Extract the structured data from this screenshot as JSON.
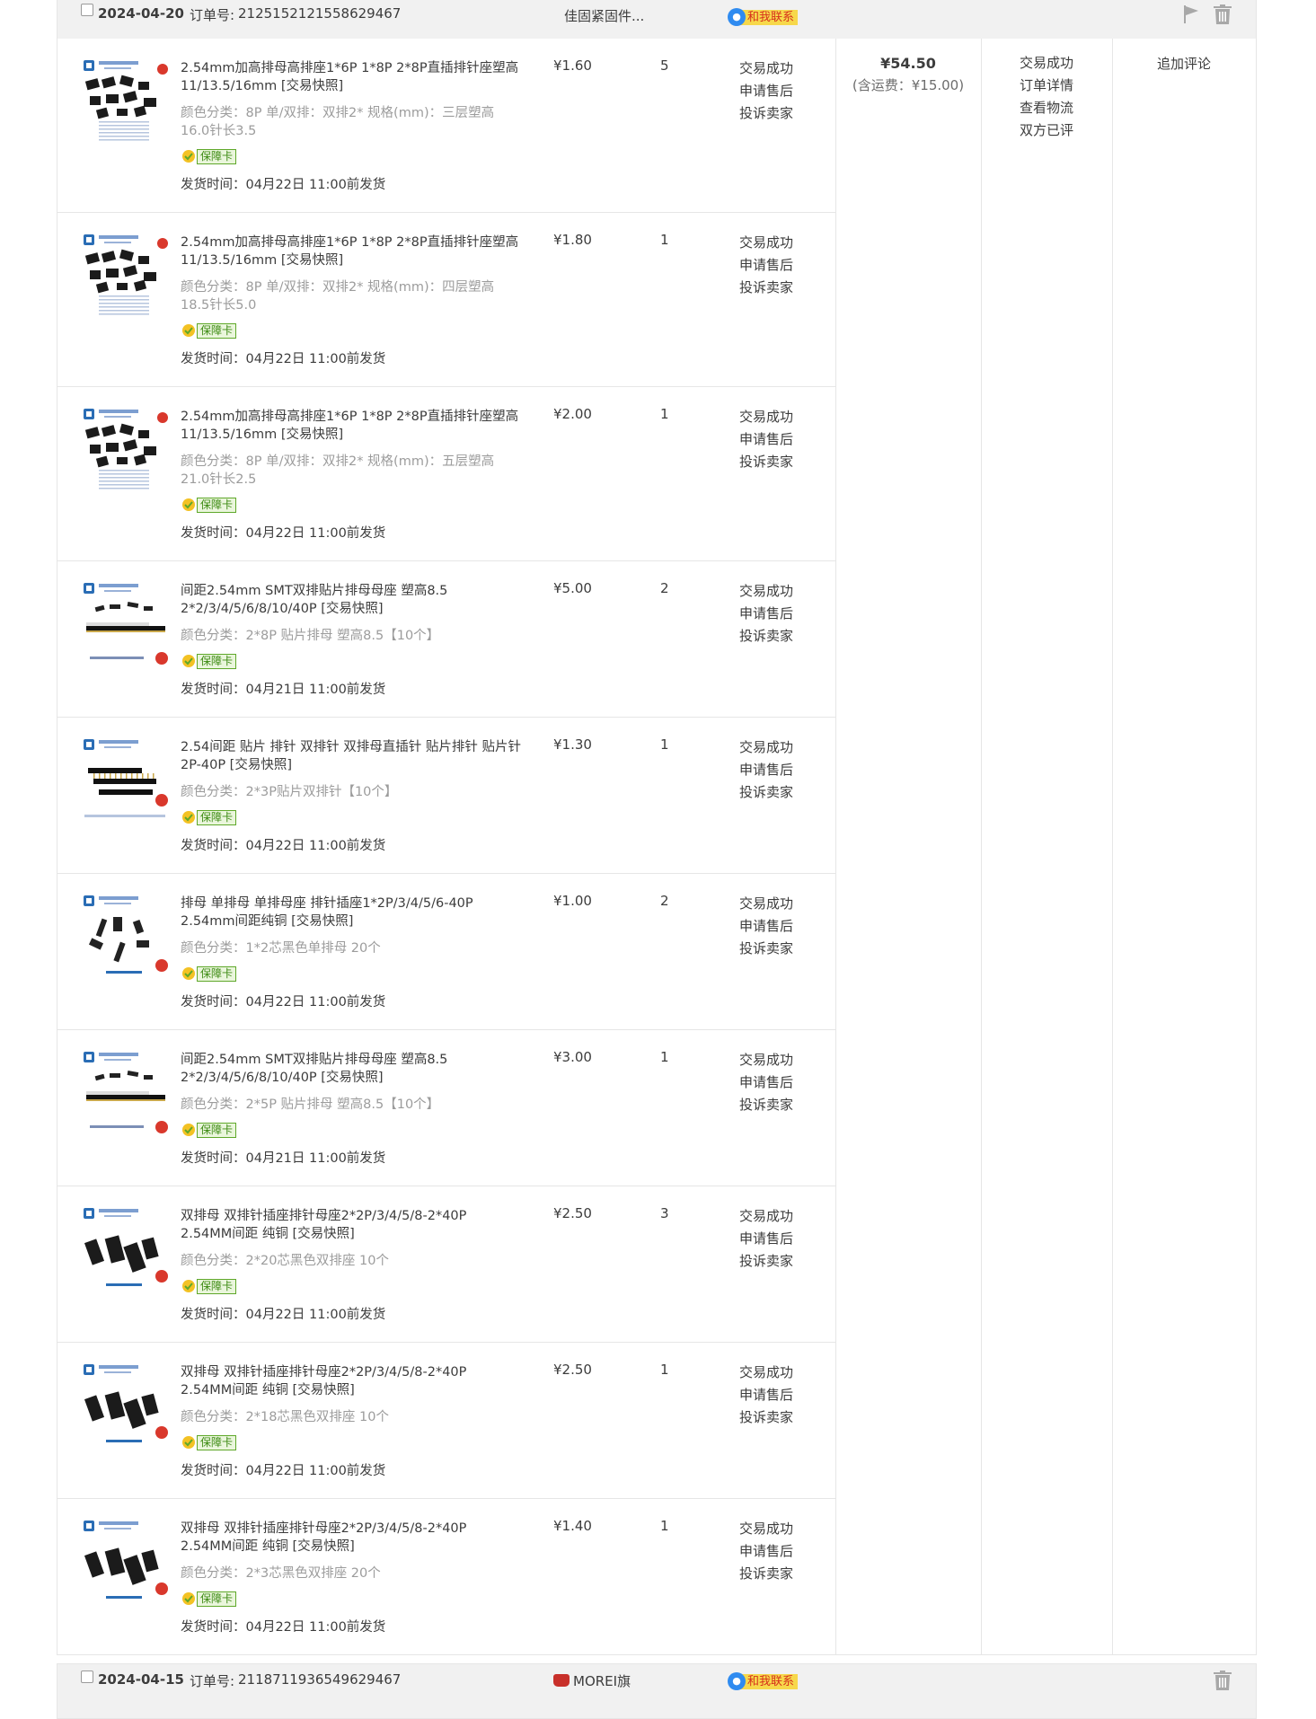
{
  "orders": [
    {
      "date": "2024-04-20",
      "order_no_label": "订单号:",
      "order_no": "2125152121558629467",
      "shop": "佳固紧固件...",
      "contact": "和我联系",
      "total": "¥54.50",
      "fee": "(含运费：¥15.00)",
      "status_links": [
        "交易成功",
        "订单详情",
        "查看物流",
        "双方已评"
      ],
      "review": "追加评论",
      "items": [
        {
          "title": "2.54mm加高排母高排座1*6P 1*8P 2*8P直插排针座塑高11/13.5/16mm [交易快照]",
          "sku": "颜色分类：8P  单/双排：双排2*  规格(mm)：三层塑高16.0针长3.5",
          "badge": "保障卡",
          "ship": "发货时间：04月22日 11:00前发货",
          "price": "¥1.60",
          "qty": "5",
          "ops": [
            "交易成功",
            "申请售后",
            "投诉卖家"
          ],
          "thumb": "header-bent"
        },
        {
          "title": "2.54mm加高排母高排座1*6P 1*8P 2*8P直插排针座塑高11/13.5/16mm [交易快照]",
          "sku": "颜色分类：8P  单/双排：双排2*  规格(mm)：四层塑高18.5针长5.0",
          "badge": "保障卡",
          "ship": "发货时间：04月22日 11:00前发货",
          "price": "¥1.80",
          "qty": "1",
          "ops": [
            "交易成功",
            "申请售后",
            "投诉卖家"
          ],
          "thumb": "header-bent"
        },
        {
          "title": "2.54mm加高排母高排座1*6P 1*8P 2*8P直插排针座塑高11/13.5/16mm [交易快照]",
          "sku": "颜色分类：8P  单/双排：双排2*  规格(mm)：五层塑高21.0针长2.5",
          "badge": "保障卡",
          "ship": "发货时间：04月22日 11:00前发货",
          "price": "¥2.00",
          "qty": "1",
          "ops": [
            "交易成功",
            "申请售后",
            "投诉卖家"
          ],
          "thumb": "header-bent"
        },
        {
          "title": "间距2.54mm SMT双排贴片排母母座 塑高8.5 2*2/3/4/5/6/8/10/40P [交易快照]",
          "sku": "颜色分类：2*8P 贴片排母 塑高8.5【10个】",
          "badge": "保障卡",
          "ship": "发货时间：04月21日 11:00前发货",
          "price": "¥5.00",
          "qty": "2",
          "ops": [
            "交易成功",
            "申请售后",
            "投诉卖家"
          ],
          "thumb": "smt"
        },
        {
          "title": "2.54间距 贴片 排针 双排针 双排母直插针 贴片排针 贴片针2P-40P [交易快照]",
          "sku": "颜色分类：2*3P贴片双排针【10个】",
          "badge": "保障卡",
          "ship": "发货时间：04月22日 11:00前发货",
          "price": "¥1.30",
          "qty": "1",
          "ops": [
            "交易成功",
            "申请售后",
            "投诉卖家"
          ],
          "thumb": "pins"
        },
        {
          "title": "排母 单排母 单排母座 排针插座1*2P/3/4/5/6-40P 2.54mm间距纯铜 [交易快照]",
          "sku": "颜色分类：1*2芯黑色单排母 20个",
          "badge": "保障卡",
          "ship": "发货时间：04月22日 11:00前发货",
          "price": "¥1.00",
          "qty": "2",
          "ops": [
            "交易成功",
            "申请售后",
            "投诉卖家"
          ],
          "thumb": "single"
        },
        {
          "title": "间距2.54mm SMT双排贴片排母母座 塑高8.5 2*2/3/4/5/6/8/10/40P [交易快照]",
          "sku": "颜色分类：2*5P 贴片排母 塑高8.5【10个】",
          "badge": "保障卡",
          "ship": "发货时间：04月21日 11:00前发货",
          "price": "¥3.00",
          "qty": "1",
          "ops": [
            "交易成功",
            "申请售后",
            "投诉卖家"
          ],
          "thumb": "smt"
        },
        {
          "title": "双排母 双排针插座排针母座2*2P/3/4/5/8-2*40P 2.54MM间距 纯铜 [交易快照]",
          "sku": "颜色分类：2*20芯黑色双排座 10个",
          "badge": "保障卡",
          "ship": "发货时间：04月22日 11:00前发货",
          "price": "¥2.50",
          "qty": "3",
          "ops": [
            "交易成功",
            "申请售后",
            "投诉卖家"
          ],
          "thumb": "double"
        },
        {
          "title": "双排母 双排针插座排针母座2*2P/3/4/5/8-2*40P 2.54MM间距 纯铜 [交易快照]",
          "sku": "颜色分类：2*18芯黑色双排座 10个",
          "badge": "保障卡",
          "ship": "发货时间：04月22日 11:00前发货",
          "price": "¥2.50",
          "qty": "1",
          "ops": [
            "交易成功",
            "申请售后",
            "投诉卖家"
          ],
          "thumb": "double"
        },
        {
          "title": "双排母 双排针插座排针母座2*2P/3/4/5/8-2*40P 2.54MM间距 纯铜 [交易快照]",
          "sku": "颜色分类：2*3芯黑色双排座 20个",
          "badge": "保障卡",
          "ship": "发货时间：04月22日 11:00前发货",
          "price": "¥1.40",
          "qty": "1",
          "ops": [
            "交易成功",
            "申请售后",
            "投诉卖家"
          ],
          "thumb": "double"
        }
      ]
    },
    {
      "date": "2024-04-15",
      "order_no_label": "订单号:",
      "order_no": "2118711936549629467",
      "shop": "MOREI旗",
      "contact": "和我联系"
    }
  ],
  "thumb_labels": {
    "header-bent": "加高塑件单排母",
    "smt": "贴片排母",
    "pins": "双排贴片排针",
    "single": "单排座",
    "double": "双排座"
  },
  "icons": {
    "flag": "flag-icon",
    "trash": "trash-icon",
    "contact": "chat-bubble-icon",
    "badge": "shield-badge-icon",
    "shop": "tmall-cat-icon"
  },
  "colors": {
    "header_bg": "#f1f1f1",
    "border": "#e6e6e6",
    "badge_green": "#5fa82a",
    "contact_yellow": "#f7d84b",
    "contact_red": "#d62f1c"
  }
}
